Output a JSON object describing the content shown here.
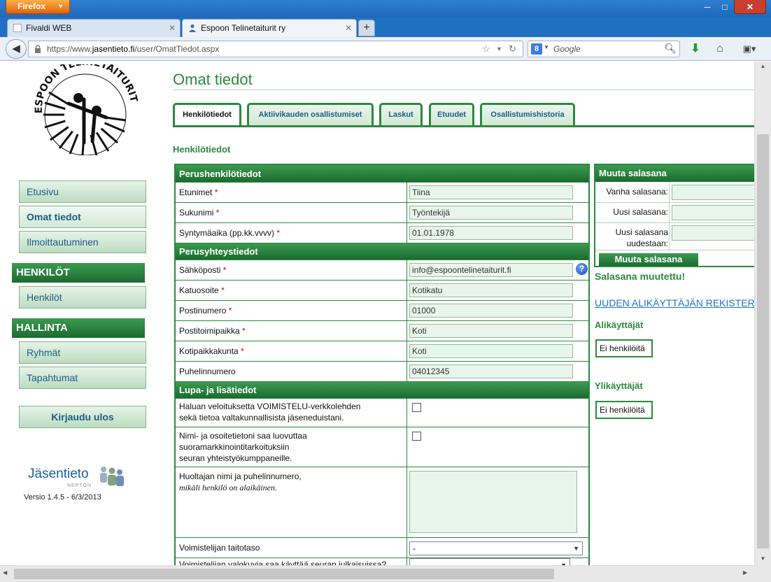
{
  "browser": {
    "app_button": "Firefox",
    "tabs": [
      {
        "label": "Fivaldi WEB",
        "active": false
      },
      {
        "label": "Espoon Telinetaiturit ry",
        "active": true
      }
    ],
    "url_prefix": "https://www.",
    "url_domain": "jasentieto.fi",
    "url_path": "/user/OmatTiedot.aspx",
    "search_placeholder": "Google",
    "search_engine_letter": "8"
  },
  "logo": {
    "text": "ESPOON TELINETAITURIT"
  },
  "sidebar": {
    "items": [
      {
        "label": "Etusivu"
      },
      {
        "label": "Omat tiedot",
        "active": true
      },
      {
        "label": "Ilmoittautuminen"
      }
    ],
    "section1_title": "HENKILÖT",
    "section1_items": [
      {
        "label": "Henkilöt"
      }
    ],
    "section2_title": "HALLINTA",
    "section2_items": [
      {
        "label": "Ryhmät"
      },
      {
        "label": "Tapahtumat"
      }
    ],
    "logout": "Kirjaudu ulos",
    "brand_name": "Jäsentieto",
    "brand_sub": "NEPTON",
    "version": "Versio 1.4.5 - 6/3/2013"
  },
  "main": {
    "title": "Omat tiedot",
    "tabs": [
      {
        "label": "Henkilötiedot",
        "active": true
      },
      {
        "label": "Aktiivikauden osallistumiset"
      },
      {
        "label": "Laskut"
      },
      {
        "label": "Etuudet"
      },
      {
        "label": "Osallistumishistoria"
      }
    ],
    "section_title": "Henkilötiedot",
    "basic_head": "Perushenkilötiedot",
    "fields_basic": [
      {
        "label": "Etunimet",
        "required": "*",
        "value": "Tiina"
      },
      {
        "label": "Sukunimi",
        "required": "*",
        "value": "Työntekijä"
      },
      {
        "label": "Syntymäaika (pp.kk.vvvv)",
        "required": "*",
        "value": "01.01.1978"
      }
    ],
    "contact_head": "Perusyhteystiedot",
    "fields_contact": [
      {
        "label": "Sähköposti",
        "required": "*",
        "value": "info@espoontelinetaiturit.fi"
      },
      {
        "label": "Katuosoite",
        "required": "*",
        "value": "Kotikatu"
      },
      {
        "label": "Postinumero",
        "required": "*",
        "value": "01000"
      },
      {
        "label": "Postitoimipaikka",
        "required": "*",
        "value": "Koti"
      },
      {
        "label": "Kotipaikkakunta",
        "required": "*",
        "value": "Koti"
      },
      {
        "label": "Puhelinnumero",
        "required": "",
        "value": "04012345"
      }
    ],
    "extra_head": "Lupa- ja lisätiedot",
    "consent1_l1": "Haluan veloituksetta VOIMISTELU-verkkolehden",
    "consent1_l2": "sekä tietoa valtakunnallisista jäseneduistani.",
    "consent2_l1": "Nimi- ja osoitetietoni saa luovuttaa",
    "consent2_l2": "suoramarkkinointitarkoituksiin",
    "consent2_l3": "seuran yhteistyökumppaneille.",
    "guardian_label": "Huoltajan nimi ja puhelinnumero,",
    "guardian_note": "mikäli henkilö on alaikäinen.",
    "skill_label": "Voimistelijan taitotaso",
    "skill_value": "-",
    "photo_label": "Voimistelijan valokuvia saa käyttää seuran julkaisuissa?",
    "photo_value": ""
  },
  "right": {
    "pw_head": "Muuta salasana",
    "old_pw_label": "Vanha salasana:",
    "new_pw_label": "Uusi salasana:",
    "confirm_pw_label1": "Uusi salasana",
    "confirm_pw_label2": "uudestaan:",
    "pw_button": "Muuta salasana",
    "pw_changed_msg": "Salasana muutettu!",
    "new_sub_link": "UUDEN ALIKÄYTTÄJÄN REKISTERÖINTI",
    "sub_users_head": "Alikäyttäjät",
    "sub_users_empty": "Ei henkilöitä",
    "super_users_head": "Ylikäyttäjät",
    "super_users_empty": "Ei henkilöitä"
  }
}
